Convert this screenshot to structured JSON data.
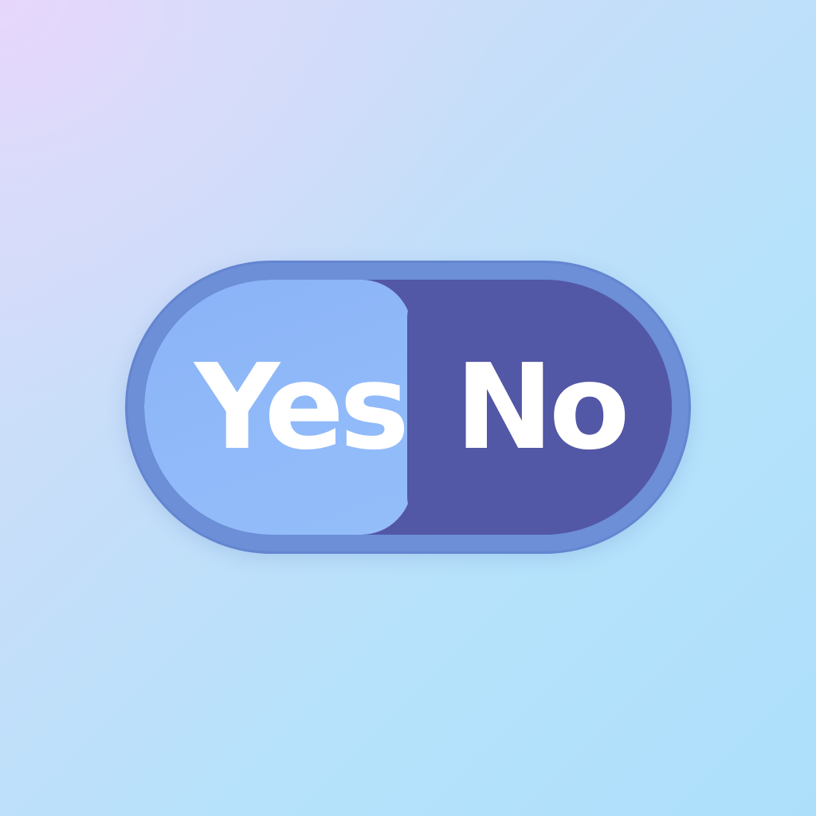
{
  "toggle": {
    "yes_label": "Yes",
    "no_label": "No",
    "selected": "No"
  },
  "colors": {
    "yes_segment": "#90baf9",
    "no_segment": "#5257a6",
    "outline": "#6c8fd7",
    "label_text": "#ffffff",
    "background_start": "#e4d8fb",
    "background_end": "#addffb"
  }
}
